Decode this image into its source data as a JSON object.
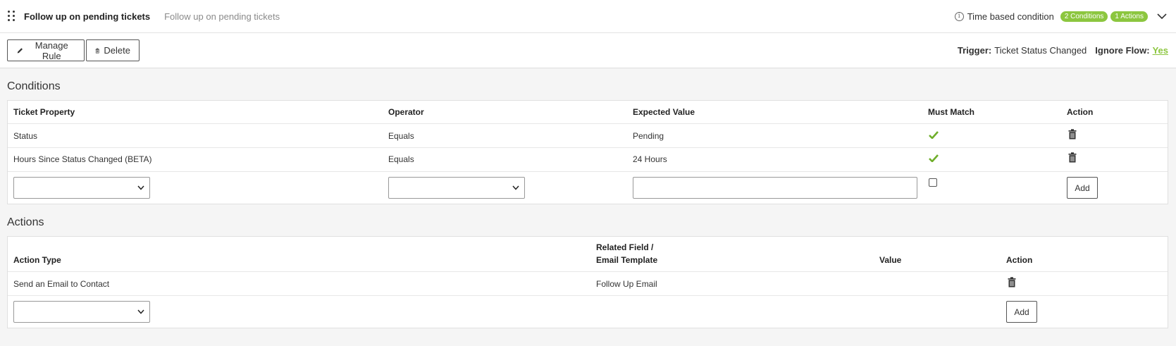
{
  "header": {
    "title": "Follow up on pending tickets",
    "description": "Follow up on pending tickets",
    "time_condition": "Time based condition",
    "badges": [
      "2 Conditions",
      "1 Actions"
    ]
  },
  "toolbar": {
    "manage_label": "Manage Rule",
    "delete_label": "Delete",
    "trigger_label": "Trigger:",
    "trigger_value": "Ticket Status Changed",
    "ignore_flow_label": "Ignore Flow:",
    "ignore_flow_value": "Yes"
  },
  "conditions": {
    "title": "Conditions",
    "columns": [
      "Ticket Property",
      "Operator",
      "Expected Value",
      "Must Match",
      "Action"
    ],
    "rows": [
      {
        "property": "Status",
        "operator": "Equals",
        "value": "Pending",
        "must_match": true
      },
      {
        "property": "Hours Since Status Changed (BETA)",
        "operator": "Equals",
        "value": "24 Hours",
        "must_match": true
      }
    ],
    "add_label": "Add"
  },
  "actions": {
    "title": "Actions",
    "columns": [
      "Action Type",
      "Related Field /",
      "Email Template",
      "Value",
      "Action"
    ],
    "rows": [
      {
        "type": "Send an Email to Contact",
        "related": "Follow Up Email",
        "value": ""
      }
    ],
    "add_label": "Add"
  },
  "colors": {
    "accent": "#8cc63f"
  }
}
